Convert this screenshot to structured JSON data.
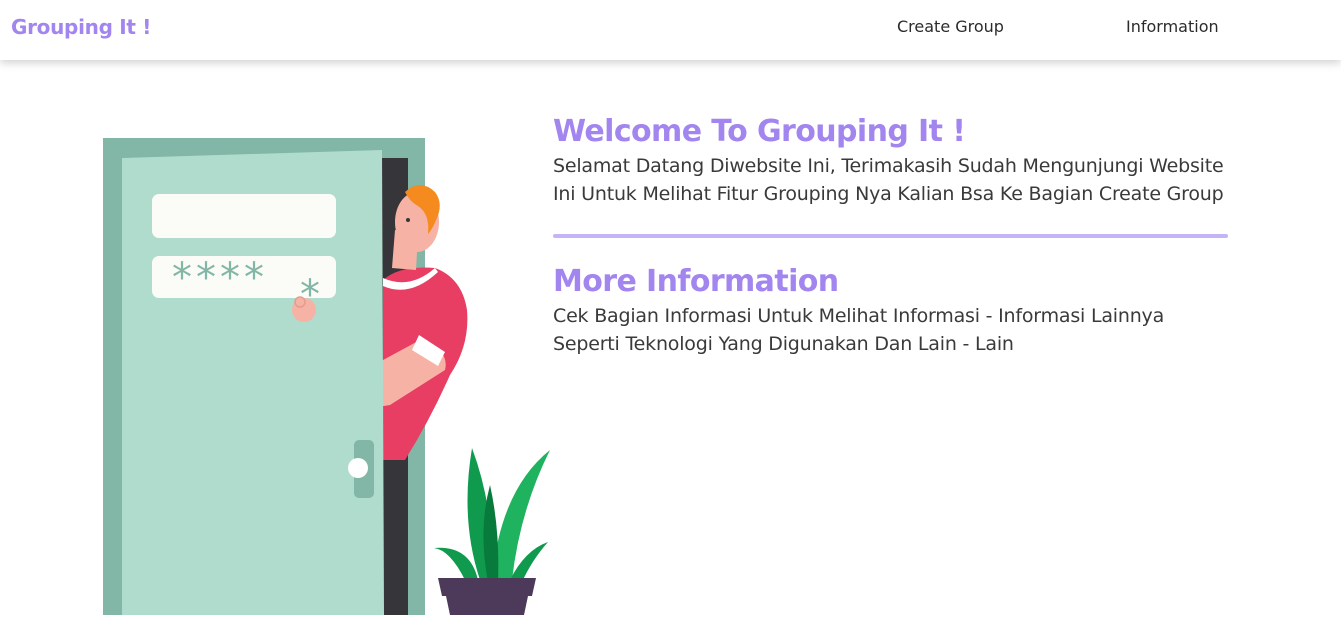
{
  "navbar": {
    "brand": "Grouping It !",
    "links": [
      {
        "label": "Create Group"
      },
      {
        "label": "Information"
      }
    ]
  },
  "welcome": {
    "title": "Welcome To Grouping It !",
    "text": "Selamat Datang Diwebsite Ini, Terimakasih Sudah Mengunjungi Website Ini Untuk Melihat Fitur Grouping Nya Kalian Bsa Ke Bagian Create Group"
  },
  "more": {
    "title": "More Information",
    "text": "Cek Bagian Informasi Untuk Melihat Informasi - Informasi Lainnya Seperti Teknologi Yang Digunakan Dan Lain - Lain"
  },
  "illustration": {
    "password_mask": "****",
    "colors": {
      "door_frame": "#82b6a6",
      "door": "#b0dccd",
      "shirt": "#e83e63",
      "skin": "#f6b3a5",
      "hair": "#f58a1e",
      "plant": "#0f9a4e",
      "pot": "#4d3a5a",
      "accent": "#a285ee"
    }
  }
}
